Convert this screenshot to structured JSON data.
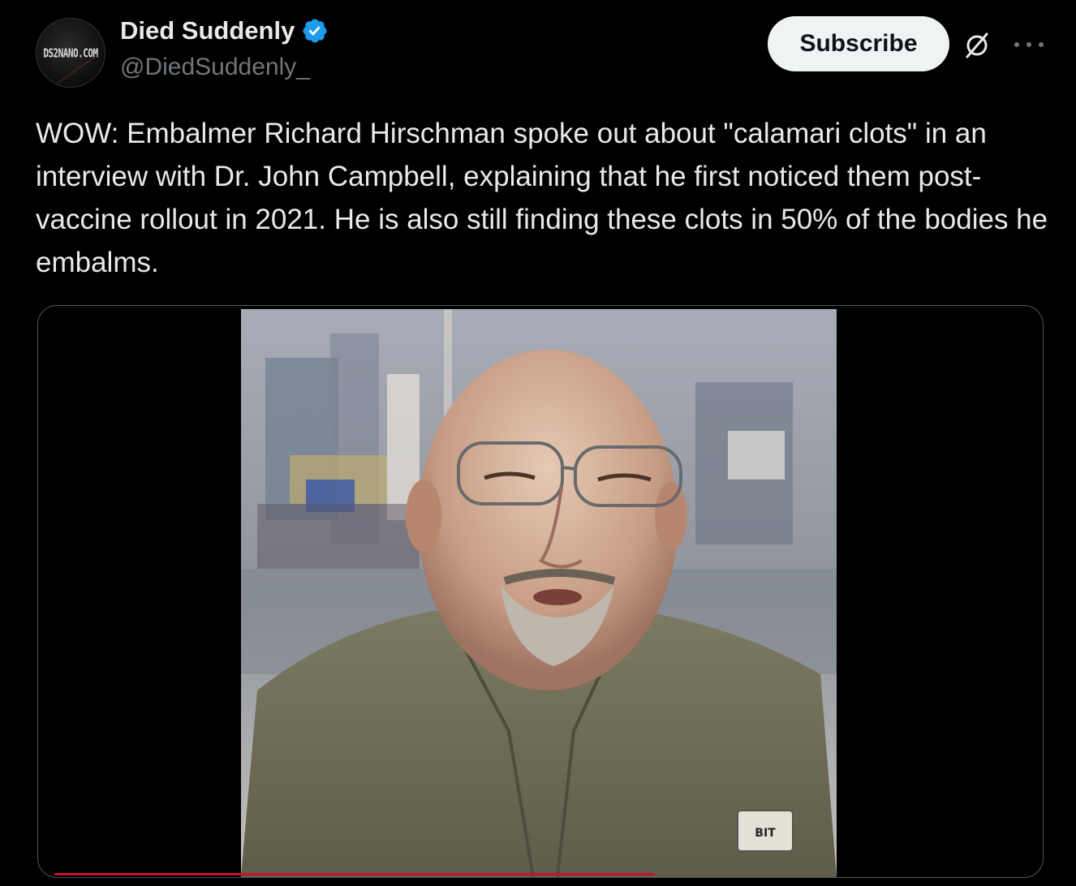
{
  "author": {
    "display_name": "Died Suddenly",
    "handle": "@DiedSuddenly_",
    "avatar_text": "DS2NANO.COM",
    "verified": true
  },
  "actions": {
    "subscribe_label": "Subscribe",
    "grok_icon": "grok-icon",
    "more_icon": "more-icon"
  },
  "tweet": {
    "text": "WOW: Embalmer Richard Hirschman spoke out about \"calamari clots\" in an interview with Dr. John Campbell, explaining that he first noticed them post-vaccine rollout in 2021. He is also still finding these clots in 50% of the bodies he embalms."
  },
  "media": {
    "type": "video",
    "shirt_badge_text": "BIT",
    "playback_progress": 0.6
  },
  "colors": {
    "background": "#000000",
    "text_primary": "#e7e9ea",
    "text_secondary": "#71767b",
    "verified_blue": "#1d9bf0",
    "subscribe_bg": "#eff3f4",
    "progress": "#c8102e"
  }
}
